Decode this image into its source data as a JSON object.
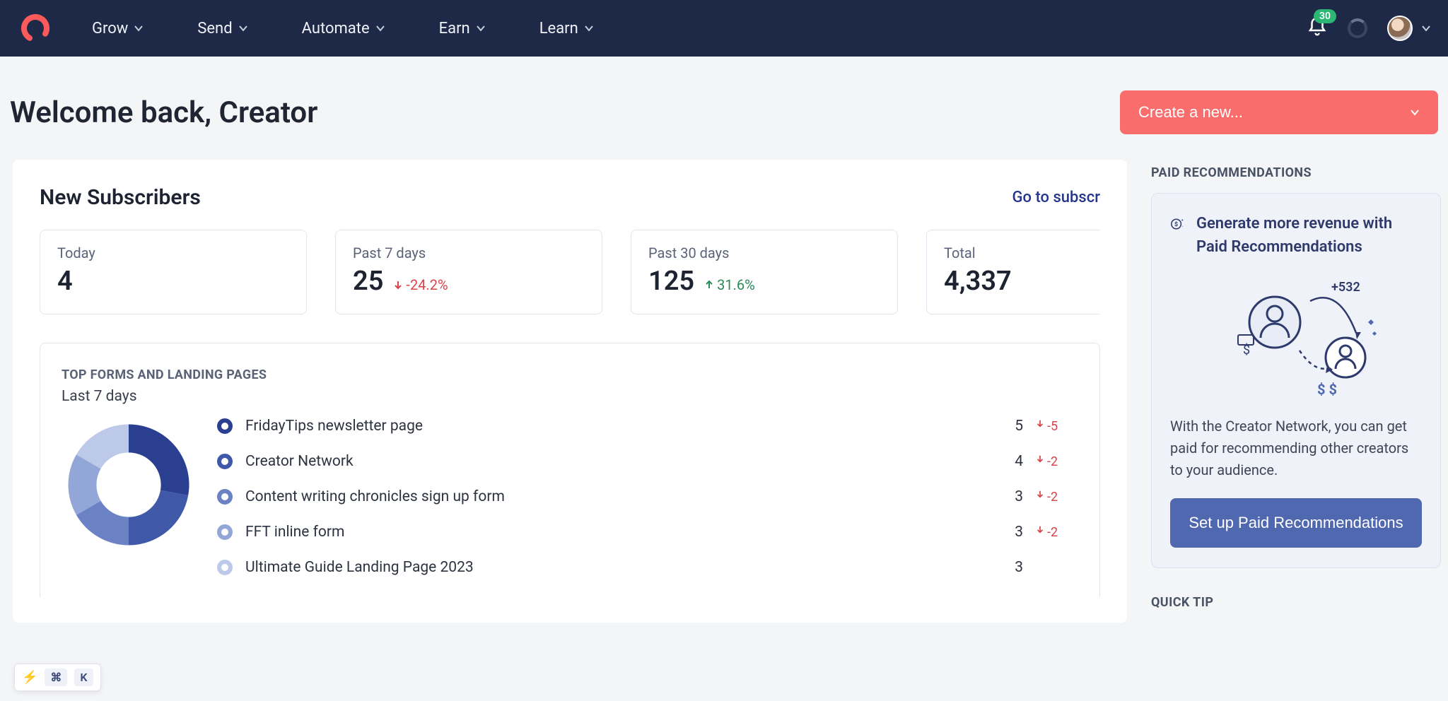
{
  "nav": {
    "items": [
      "Grow",
      "Send",
      "Automate",
      "Earn",
      "Learn"
    ],
    "notifications": "30"
  },
  "header": {
    "title": "Welcome back, Creator",
    "create_label": "Create a new..."
  },
  "subscribers": {
    "title": "New Subscribers",
    "link": "Go to subscr",
    "cards": [
      {
        "label": "Today",
        "value": "4",
        "delta": "",
        "dir": ""
      },
      {
        "label": "Past 7 days",
        "value": "25",
        "delta": "-24.2%",
        "dir": "down"
      },
      {
        "label": "Past 30 days",
        "value": "125",
        "delta": "31.6%",
        "dir": "up"
      },
      {
        "label": "Total",
        "value": "4,337",
        "delta": "",
        "dir": ""
      }
    ]
  },
  "top_forms": {
    "title": "TOP FORMS AND LANDING PAGES",
    "subtitle": "Last 7 days",
    "rows": [
      {
        "name": "FridayTips newsletter page",
        "count": "5",
        "delta": "-5",
        "color": "#2a3f8f"
      },
      {
        "name": "Creator Network",
        "count": "4",
        "delta": "-2",
        "color": "#3f58a8"
      },
      {
        "name": "Content writing chronicles sign up form",
        "count": "3",
        "delta": "-2",
        "color": "#6b82c4"
      },
      {
        "name": "FFT inline form",
        "count": "3",
        "delta": "-2",
        "color": "#93a6d8"
      },
      {
        "name": "Ultimate Guide Landing Page 2023",
        "count": "3",
        "delta": "",
        "color": "#bcc9e9"
      }
    ]
  },
  "sidebar": {
    "paid_title": "PAID RECOMMENDATIONS",
    "promo_head": "Generate more revenue with Paid Recommendations",
    "promo_plus": "+532",
    "promo_desc": "With the Creator Network, you can get paid for recommending other creators to your audience.",
    "promo_btn": "Set up Paid Recommendations",
    "quick_tip": "QUICK TIP"
  },
  "shortcut": {
    "cmd": "⌘",
    "key": "K"
  },
  "chart_data": {
    "type": "pie",
    "title": "Top forms and landing pages — last 7 days",
    "categories": [
      "FridayTips newsletter page",
      "Creator Network",
      "Content writing chronicles sign up form",
      "FFT inline form",
      "Ultimate Guide Landing Page 2023"
    ],
    "values": [
      5,
      4,
      3,
      3,
      3
    ],
    "colors": [
      "#2a3f8f",
      "#3f58a8",
      "#6b82c4",
      "#93a6d8",
      "#bcc9e9"
    ]
  }
}
